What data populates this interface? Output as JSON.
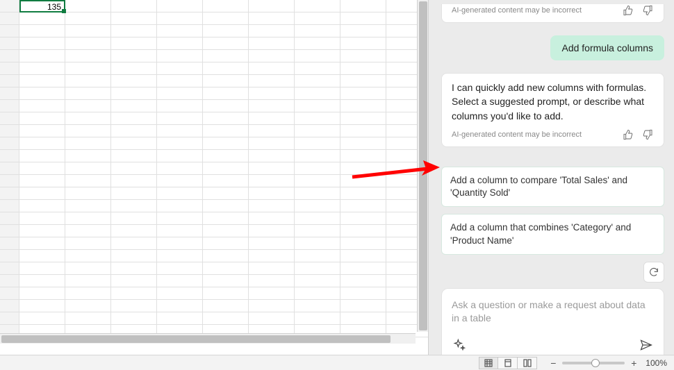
{
  "sheet": {
    "visibleValue": "135"
  },
  "copilot": {
    "disclaimer": "AI-generated content may be incorrect",
    "userMessage": "Add formula columns",
    "assistantMessage": "I can quickly add new columns with formulas. Select a suggested prompt, or describe what columns you'd like to add.",
    "suggestions": [
      "Add a column to compare 'Total Sales' and 'Quantity Sold'",
      "Add a column that combines 'Category' and 'Product Name'"
    ],
    "inputPlaceholder": "Ask a question or make a request about data in a table"
  },
  "status": {
    "zoom": "100%"
  }
}
